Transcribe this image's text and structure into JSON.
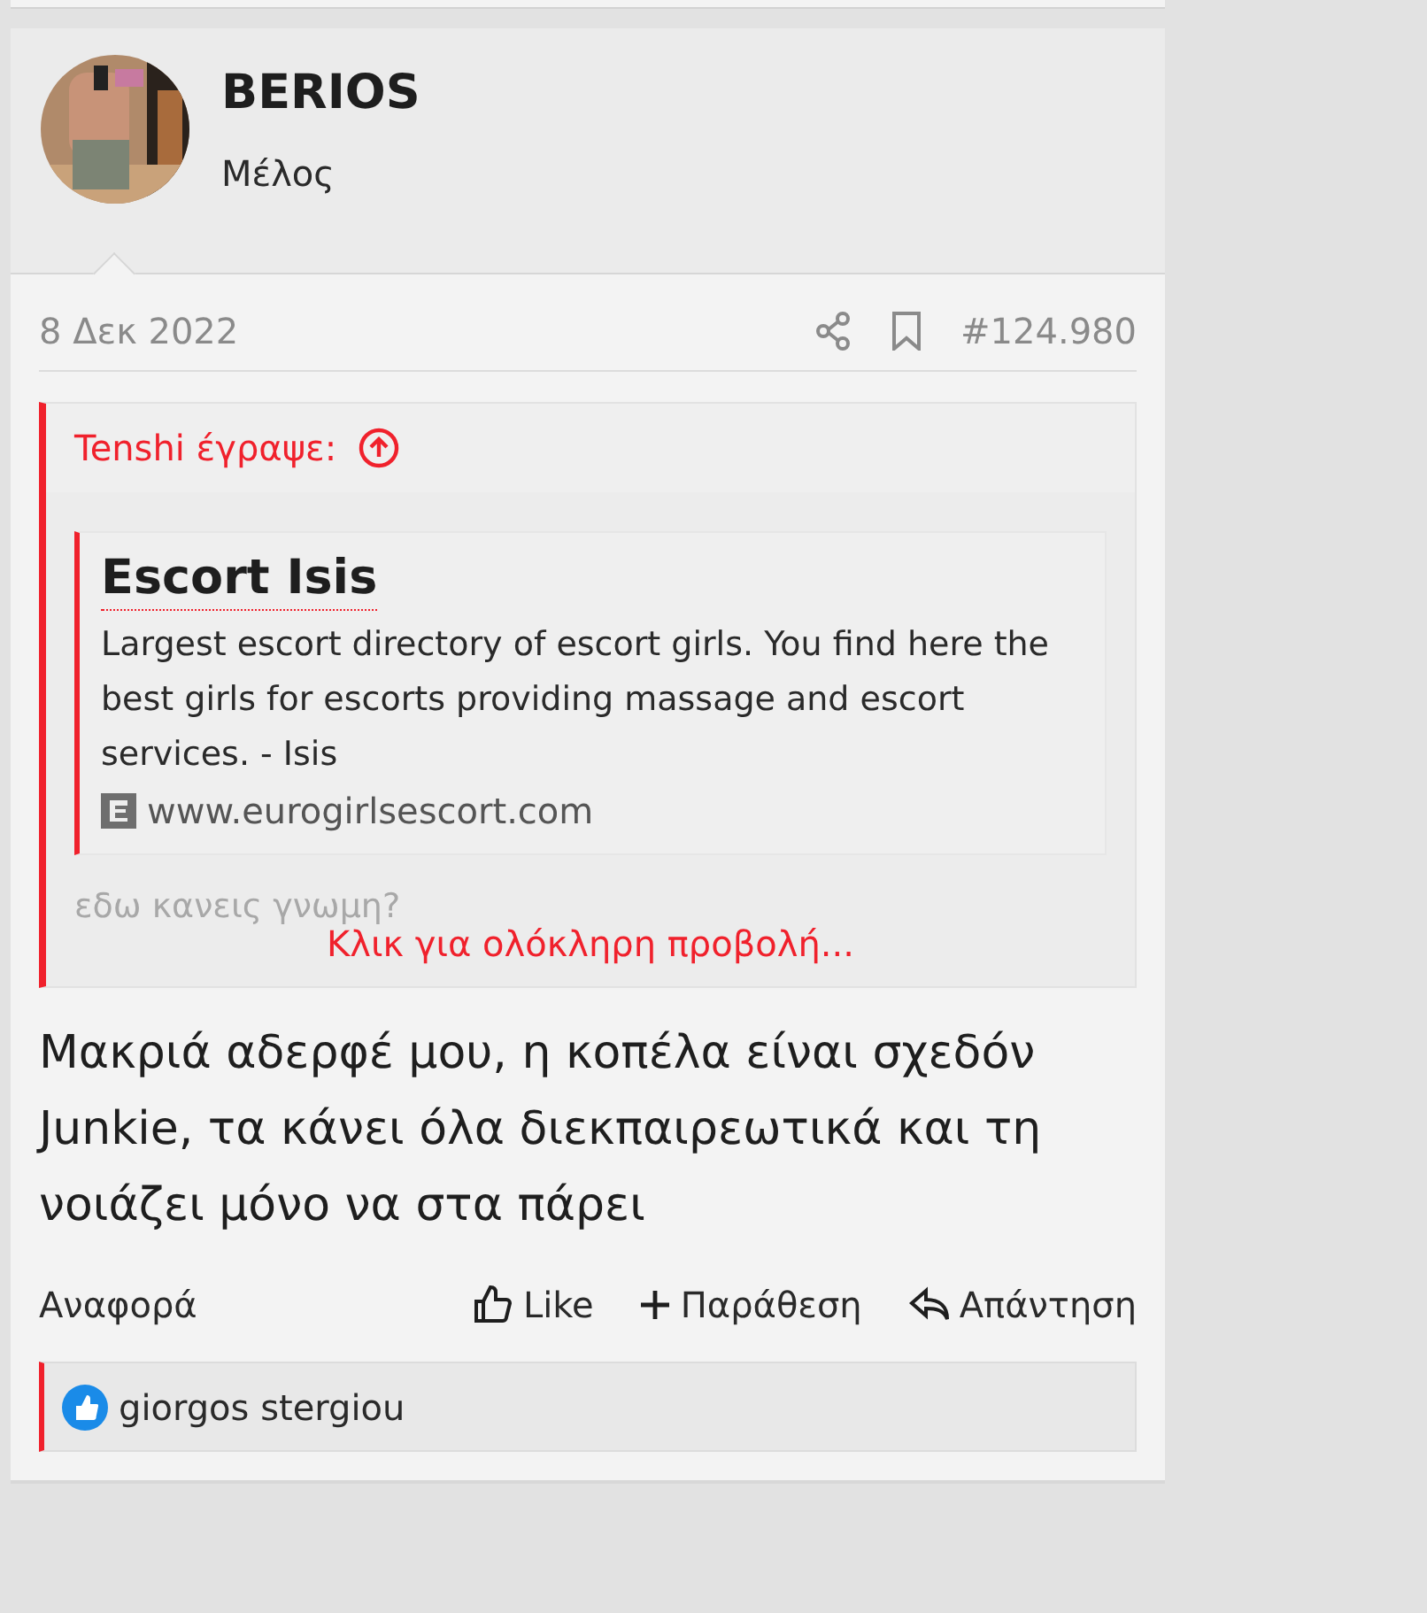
{
  "author": {
    "name": "BERIOS",
    "role": "Μέλος"
  },
  "post": {
    "date": "8 Δεκ 2022",
    "number": "#124.980"
  },
  "quote": {
    "attribution": "Tenshi έγραψε:",
    "embed": {
      "title": "Escort Isis",
      "description": "Largest escort directory of escort girls. You find here the best girls for escorts providing massage and escort services. - Isis",
      "url": "www.eurogirlsescort.com"
    },
    "faded_text": "εδω κανεις γνωμη?",
    "expand_link": "Κλικ για ολόκληρη προβολή..."
  },
  "body": "Μακριά αδερφέ μου, η κοπέλα είναι σχεδόν Junkie, τα κάνει όλα διεκπαιρεωτικά και τη νοιάζει μόνο να στα πάρει",
  "actions": [
    {
      "kind": "report",
      "label": "Αναφορά"
    },
    {
      "kind": "like",
      "label": "Like"
    },
    {
      "kind": "quote",
      "label": "Παράθεση"
    },
    {
      "kind": "reply",
      "label": "Απάντηση"
    }
  ],
  "reactions": {
    "names": "giorgos stergiou"
  }
}
